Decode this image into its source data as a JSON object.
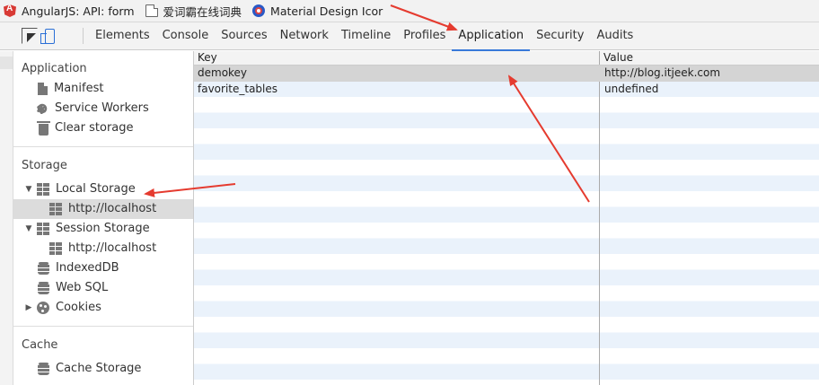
{
  "bookmarks": [
    {
      "label": "AngularJS: API: form",
      "icon": "angular-icon"
    },
    {
      "label": "爱词霸在线词典",
      "icon": "page-icon"
    },
    {
      "label": "Material Design Icor",
      "icon": "material-design-icon"
    }
  ],
  "devtools": {
    "tabs": [
      "Elements",
      "Console",
      "Sources",
      "Network",
      "Timeline",
      "Profiles",
      "Application",
      "Security",
      "Audits"
    ],
    "active_tab": "Application"
  },
  "sidebar": {
    "application": {
      "title": "Application",
      "items": [
        {
          "label": "Manifest",
          "icon": "manifest-icon"
        },
        {
          "label": "Service Workers",
          "icon": "gear-icon"
        },
        {
          "label": "Clear storage",
          "icon": "trash-icon"
        }
      ]
    },
    "storage": {
      "title": "Storage",
      "local_storage": {
        "label": "Local Storage",
        "child": "http://localhost"
      },
      "session_storage": {
        "label": "Session Storage",
        "child": "http://localhost"
      },
      "indexeddb": "IndexedDB",
      "websql": "Web SQL",
      "cookies": "Cookies"
    },
    "cache": {
      "title": "Cache",
      "cache_storage": "Cache Storage"
    }
  },
  "table": {
    "headers": {
      "key": "Key",
      "value": "Value"
    },
    "rows": [
      {
        "key": "demokey",
        "value": "http://blog.itjeek.com"
      },
      {
        "key": "favorite_tables",
        "value": "undefined"
      }
    ]
  },
  "colors": {
    "accent": "#3879d9",
    "annotation": "#e53b2f"
  }
}
